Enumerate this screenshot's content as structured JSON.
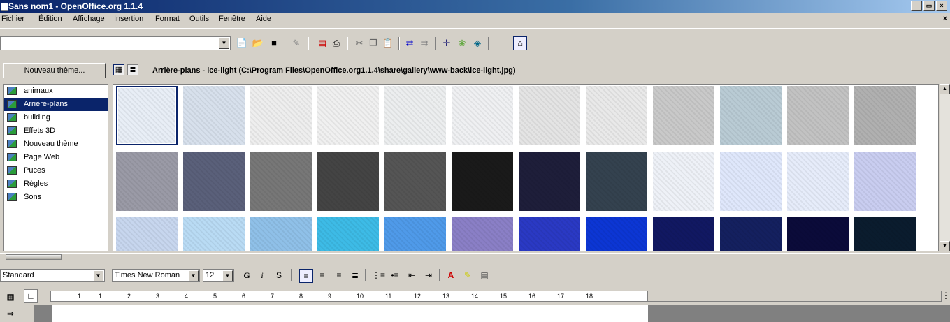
{
  "window": {
    "title": "Sans nom1 - OpenOffice.org 1.1.4",
    "controls": {
      "minimize": "_",
      "restore": "▭",
      "close": "×"
    }
  },
  "menu": {
    "items": [
      "Fichier",
      "Édition",
      "Affichage",
      "Insertion",
      "Format",
      "Outils",
      "Fenêtre",
      "Aide"
    ],
    "doc_close": "×"
  },
  "toolbar": {
    "url_value": "",
    "icons": [
      "edit-file-icon",
      "open-folder-icon",
      "save-icon",
      "edit-mode-icon",
      "export-pdf-icon",
      "print-icon",
      "cut-icon",
      "copy-icon",
      "paste-icon",
      "undo-icon",
      "redo-icon",
      "navigator-icon",
      "gallery-icon",
      "data-sources-icon",
      "hyperlink-icon"
    ]
  },
  "gallery": {
    "new_theme_label": "Nouveau thème...",
    "path": "Arrière-plans - ice-light (C:\\Program Files\\OpenOffice.org1.1.4\\share\\gallery\\www-back\\ice-light.jpg)",
    "themes": [
      "animaux",
      "Arrière-plans",
      "building",
      "Effets 3D",
      "Nouveau thème",
      "Page Web",
      "Puces",
      "Règles",
      "Sons"
    ],
    "selected_theme_index": 1,
    "thumbnails": [
      [
        "#e8eef6",
        "#d7e0ec",
        "#eeeeee",
        "#f0f0f0",
        "#eceeef",
        "#eff0f2",
        "#e4e4e4",
        "#e9e9e9",
        "#c9c9c9",
        "#b9cbd4",
        "#c2c2c2",
        "#b0b0b0"
      ],
      [
        "#9a9aa6",
        "#5a607a",
        "#777777",
        "#444444",
        "#555555",
        "#1a1a1a",
        "#1e1e3a",
        "#34424f",
        "#eef1f7",
        "#dfe7fb",
        "#e6ecfa",
        "#c9cdf0"
      ],
      [
        "#c7d6ee",
        "#b9dbf4",
        "#8fc0e8",
        "#3dbbe6",
        "#4f9ae9",
        "#8a7fc6",
        "#2a39c4",
        "#0c36d4",
        "#111862",
        "#14205f",
        "#0b0b3a",
        "#0a1c2e"
      ]
    ]
  },
  "format_bar": {
    "style": "Standard",
    "font": "Times New Roman",
    "size": "12",
    "bold": "G",
    "italic": "i",
    "underline": "S"
  },
  "ruler": {
    "labels": [
      "1",
      "1",
      "2",
      "3",
      "4",
      "5",
      "6",
      "7",
      "8",
      "9",
      "10",
      "11",
      "12",
      "13",
      "14",
      "15",
      "16",
      "17",
      "18"
    ]
  }
}
